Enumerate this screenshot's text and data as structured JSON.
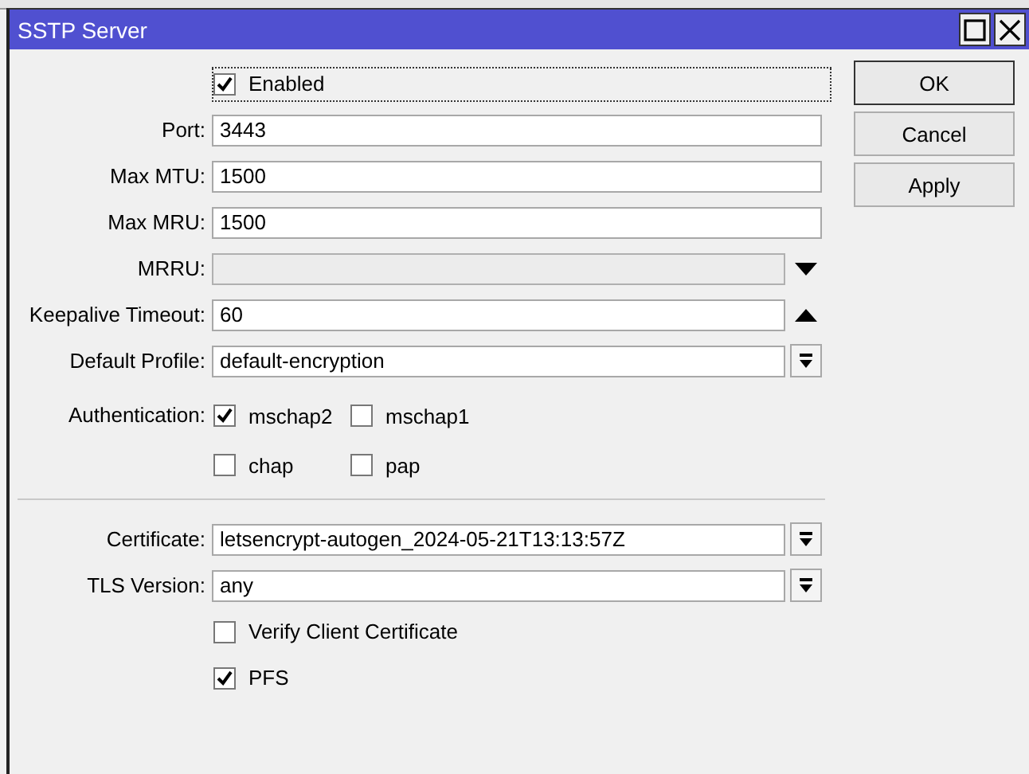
{
  "window": {
    "title": "SSTP Server"
  },
  "rows": [
    {
      "kind": "checkbox",
      "label": "Enabled",
      "checked": true,
      "focused": true
    },
    {
      "kind": "text",
      "label": "Port:",
      "value": "3443"
    },
    {
      "kind": "text",
      "label": "Max MTU:",
      "value": "1500"
    },
    {
      "kind": "text",
      "label": "Max MRU:",
      "value": "1500"
    },
    {
      "kind": "spin",
      "label": "MRRU:",
      "disabled": true,
      "expanded": false
    },
    {
      "kind": "spin",
      "label": "Keepalive Timeout:",
      "value": "60",
      "disabled": false,
      "expanded": true
    },
    {
      "kind": "select",
      "label": "Default Profile:",
      "value": "default-encryption"
    },
    {
      "kind": "checks",
      "label": "Authentication:",
      "options": [
        {
          "label": "mschap2",
          "checked": true
        },
        {
          "label": "mschap1",
          "checked": false
        },
        {
          "label": "chap",
          "checked": false
        },
        {
          "label": "pap",
          "checked": false
        }
      ]
    },
    {
      "kind": "separator"
    },
    {
      "kind": "select",
      "label": "Certificate:",
      "value": "letsencrypt-autogen_2024-05-21T13:13:57Z"
    },
    {
      "kind": "select",
      "label": "TLS Version:",
      "value": "any"
    },
    {
      "kind": "checkbox",
      "label": "Verify Client Certificate",
      "checked": false,
      "focused": false
    },
    {
      "kind": "checkbox",
      "label": "PFS",
      "checked": true,
      "focused": false
    }
  ],
  "buttons": [
    "OK",
    "Cancel",
    "Apply"
  ]
}
